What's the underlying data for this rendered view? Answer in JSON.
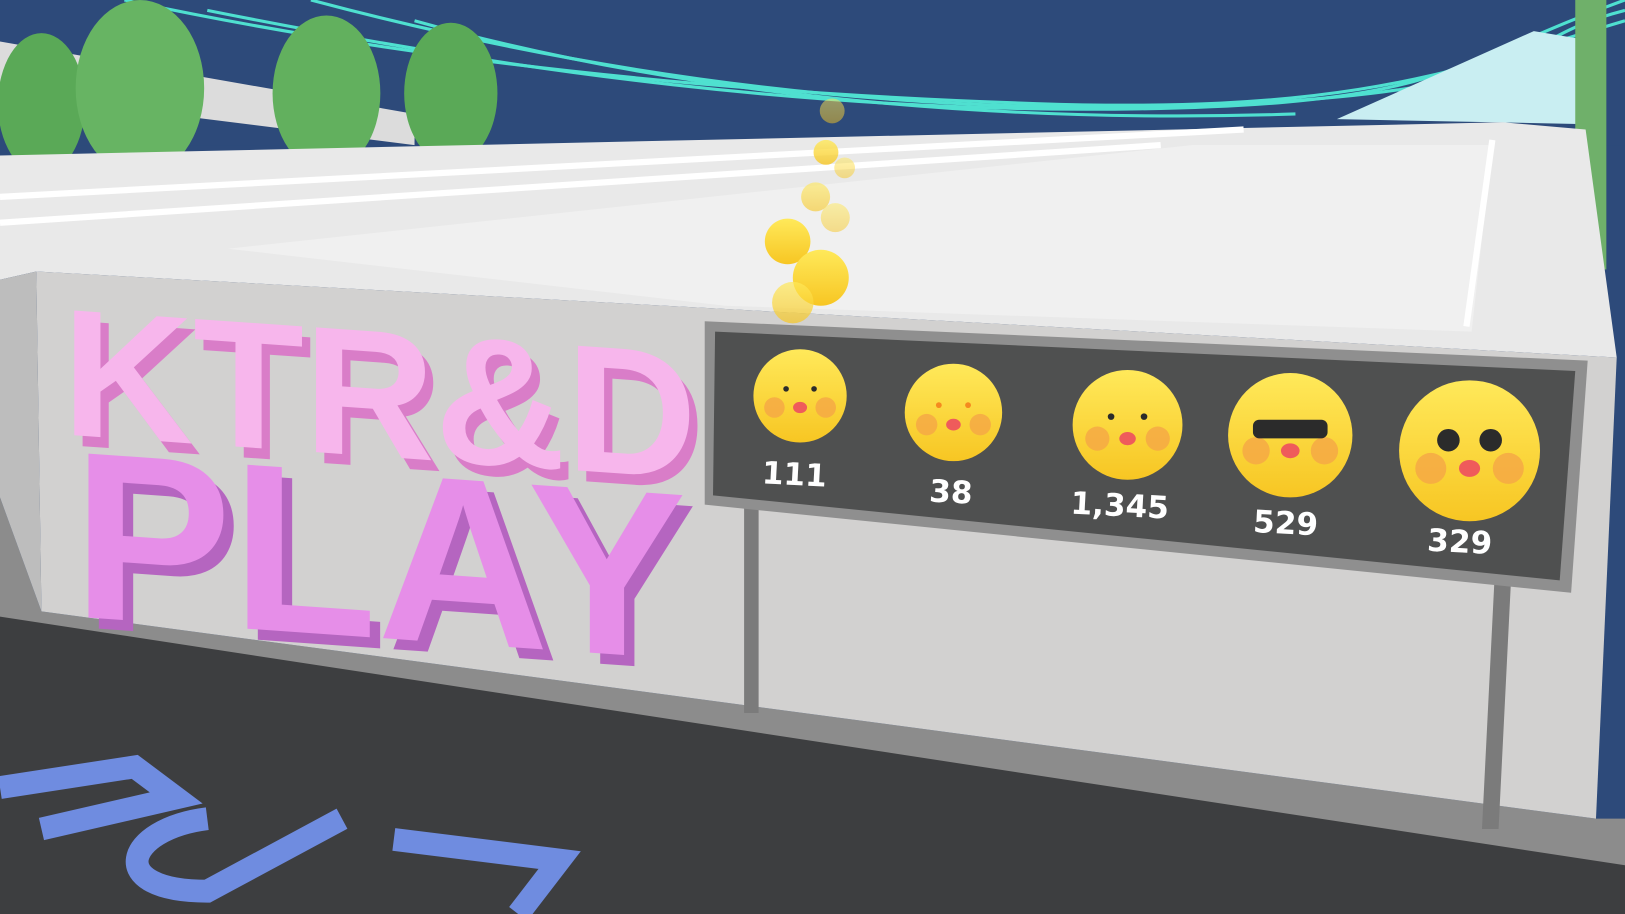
{
  "sign": {
    "line1": "KTR&D",
    "line2": "PLAY"
  },
  "reaction_board": {
    "reactions": [
      {
        "icon": "love-emoji-icon",
        "count": "111"
      },
      {
        "icon": "star-eyes-thumbs-up-emoji-icon",
        "count": "38"
      },
      {
        "icon": "singing-emoji-icon",
        "count": "1,345"
      },
      {
        "icon": "sunglasses-emoji-icon",
        "count": "529"
      },
      {
        "icon": "pleading-emoji-icon",
        "count": "329"
      }
    ]
  },
  "colors": {
    "sky": "#2d4a7a",
    "board": "#4f5050",
    "emoji": "#fbd63a",
    "sign_top": "#f7b6ec",
    "sign_bottom": "#e68ee8"
  }
}
